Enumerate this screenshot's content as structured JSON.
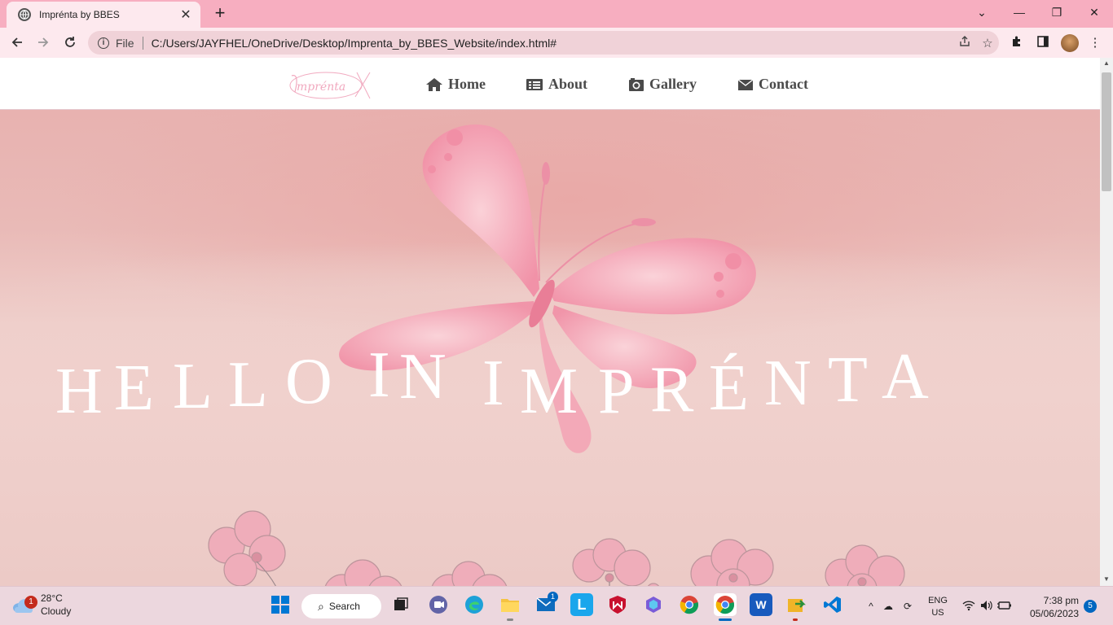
{
  "browser": {
    "tab_title": "Imprénta by BBES",
    "tab_close": "✕",
    "new_tab": "+",
    "file_label": "File",
    "url": "C:/Users/JAYFHEL/OneDrive/Desktop/Imprenta_by_BBES_Website/index.html#",
    "window_controls": [
      "⌄",
      "—",
      "❐",
      "✕"
    ]
  },
  "site": {
    "logo_text": "Imprénta",
    "nav": [
      {
        "label": "Home",
        "icon": "home-icon"
      },
      {
        "label": "About",
        "icon": "list-icon"
      },
      {
        "label": "Gallery",
        "icon": "camera-icon"
      },
      {
        "label": "Contact",
        "icon": "envelope-icon"
      }
    ],
    "hero_words": [
      "H",
      "E",
      "L",
      "L",
      "O",
      "I",
      "N",
      "I",
      "M",
      "P",
      "R",
      "É",
      "N",
      "T",
      "A"
    ],
    "colors": {
      "accent": "#f7aec0",
      "nav_text": "#4a4a4a",
      "hero_text": "#ffffff"
    }
  },
  "taskbar": {
    "weather_temp": "28°C",
    "weather_desc": "Cloudy",
    "weather_badge": "1",
    "search_label": "Search",
    "mail_badge": "1",
    "lang_line1": "ENG",
    "lang_line2": "US",
    "time": "7:38 pm",
    "date": "05/06/2023",
    "notification_count": "5",
    "word_letter": "W"
  }
}
